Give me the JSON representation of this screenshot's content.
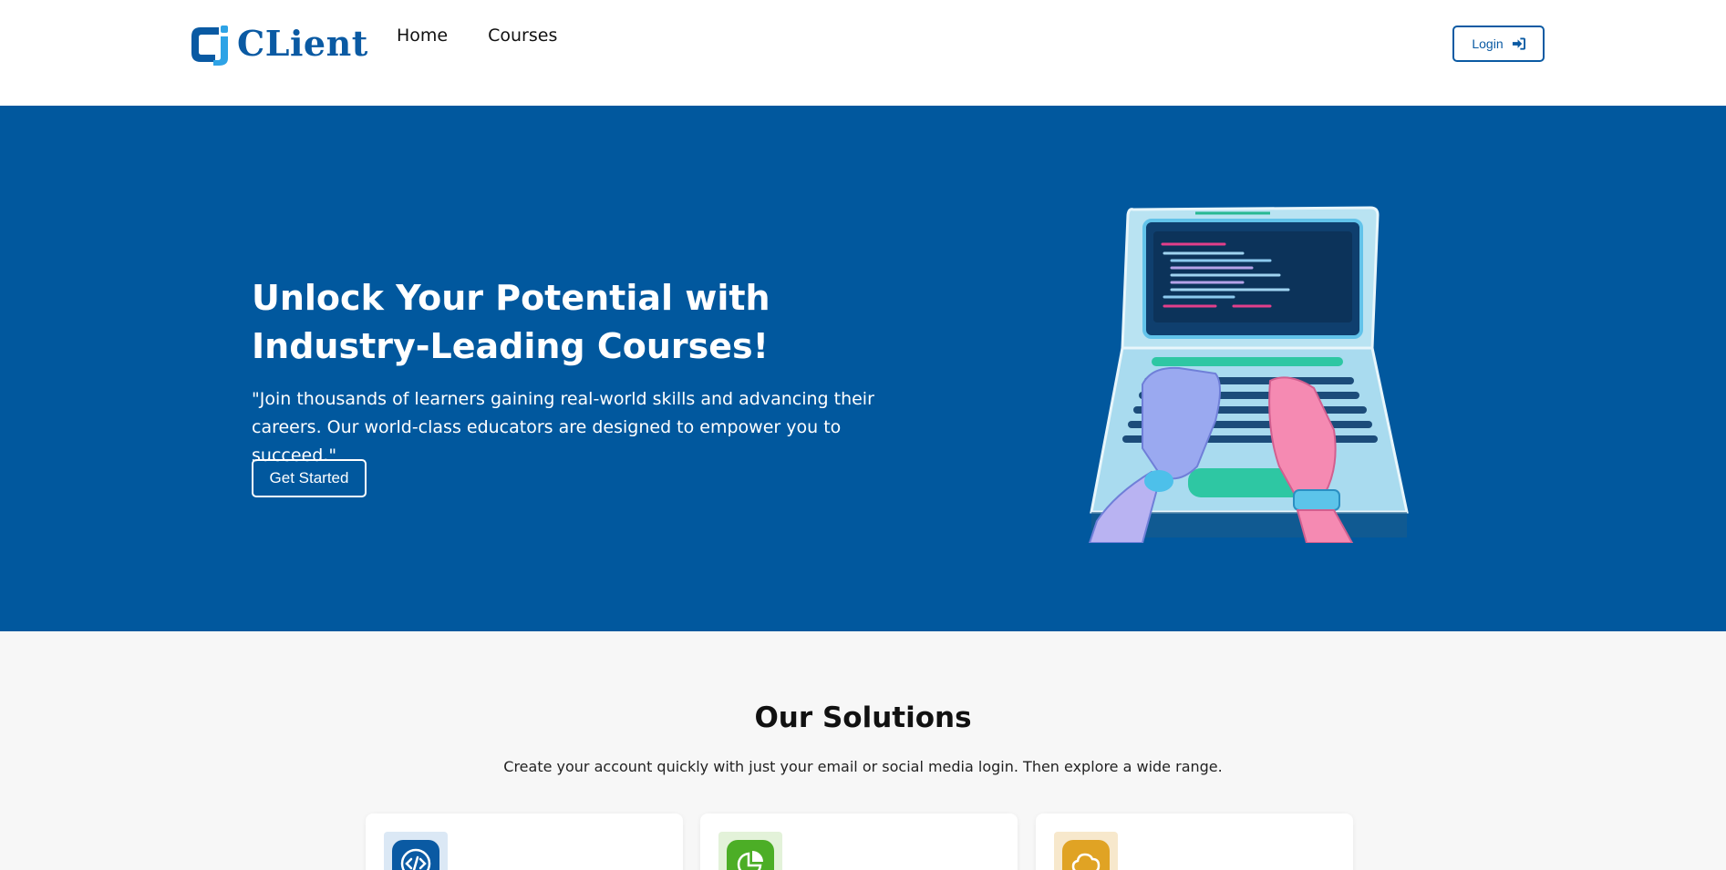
{
  "header": {
    "logo_text": "CLient",
    "nav": [
      {
        "label": "Home"
      },
      {
        "label": "Courses"
      }
    ],
    "login_label": "Login"
  },
  "hero": {
    "title_line1": "Unlock Your Potential with",
    "title_line2": "Industry-Leading Courses!",
    "subtitle": "\"Join thousands of learners gaining real-world skills and advancing their careers. Our world-class educators are designed to empower you to succeed.\"",
    "cta_label": "Get Started",
    "background": "#01589e"
  },
  "solutions": {
    "title": "Our Solutions",
    "subtitle": "Create your account quickly with just your email or social media login. Then explore a wide range.",
    "cards": [
      {
        "icon": "code-icon",
        "bg": "#dbe8f5",
        "fg": "#0a5aa3"
      },
      {
        "icon": "pie-chart-icon",
        "bg": "#e3f2d9",
        "fg": "#4cae26"
      },
      {
        "icon": "cloud-icon",
        "bg": "#f7e8cc",
        "fg": "#e0a324"
      }
    ]
  },
  "colors": {
    "brand": "#0a5aa3",
    "page_bg": "#f7f7f7"
  }
}
